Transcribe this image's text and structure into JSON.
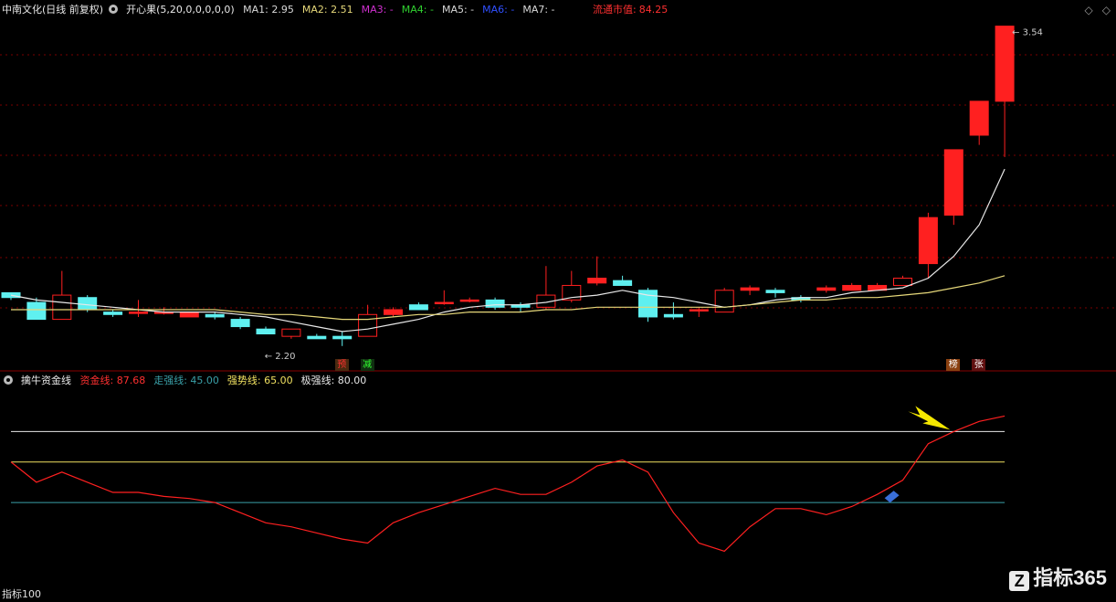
{
  "header": {
    "stock_title": "中南文化(日线 前复权)",
    "indicator_name": "开心果(5,20,0,0,0,0,0)",
    "ma": [
      {
        "label": "MA1:",
        "value": "2.95",
        "color": "#d8d8d8"
      },
      {
        "label": "MA2:",
        "value": "2.51",
        "color": "#e6d87a"
      },
      {
        "label": "MA3:",
        "value": "-",
        "color": "#d030d0"
      },
      {
        "label": "MA4:",
        "value": "-",
        "color": "#30d030"
      },
      {
        "label": "MA5:",
        "value": "-",
        "color": "#d8d8d8"
      },
      {
        "label": "MA6:",
        "value": "-",
        "color": "#3050ff"
      },
      {
        "label": "MA7:",
        "value": "-",
        "color": "#d8d8d8"
      }
    ],
    "market_cap_label": "流通市值:",
    "market_cap_value": "84.25"
  },
  "indicator_header": {
    "name": "擒牛资金线",
    "lines": [
      {
        "label": "资金线:",
        "value": "87.68",
        "color": "#ff3030"
      },
      {
        "label": "走强线:",
        "value": "45.00",
        "color": "#3aa0a8"
      },
      {
        "label": "强势线:",
        "value": "65.00",
        "color": "#f0e060"
      },
      {
        "label": "极强线:",
        "value": "80.00",
        "color": "#e8e8e8"
      }
    ]
  },
  "corner_icons": [
    "diamond-icon",
    "diamond-outline-icon"
  ],
  "footer_label": "指标100",
  "watermark": {
    "logo": "Z",
    "text": "指标365"
  },
  "colors": {
    "up": "#ff2020",
    "down": "#5ff0f0",
    "ma1": "#e8e8e8",
    "ma2": "#e6d87a",
    "grid": "#7a0000"
  },
  "chart_data": [
    {
      "type": "candlestick",
      "title": "中南文化(日线 前复权)",
      "annotations": {
        "high_label": "3.54",
        "low_label": "2.20"
      },
      "signal_tags": [
        {
          "index": 13,
          "text": "预",
          "color": "#ff3030",
          "bg": "#4a2a10"
        },
        {
          "index": 14,
          "text": "减",
          "color": "#30ff30",
          "bg": "#103010"
        },
        {
          "index": 37,
          "text": "榜",
          "color": "#ffffff",
          "bg": "#8a4010"
        },
        {
          "index": 38,
          "text": "张",
          "color": "#ffffff",
          "bg": "#601010"
        }
      ],
      "ylim": [
        2.14,
        3.58
      ],
      "candles": [
        {
          "o": 2.44,
          "c": 2.42,
          "h": 2.44,
          "l": 2.41
        },
        {
          "o": 2.4,
          "c": 2.33,
          "h": 2.42,
          "l": 2.33
        },
        {
          "o": 2.33,
          "c": 2.43,
          "h": 2.53,
          "l": 2.33
        },
        {
          "o": 2.42,
          "c": 2.37,
          "h": 2.43,
          "l": 2.36
        },
        {
          "o": 2.36,
          "c": 2.35,
          "h": 2.37,
          "l": 2.34
        },
        {
          "o": 2.36,
          "c": 2.36,
          "h": 2.41,
          "l": 2.34
        },
        {
          "o": 2.36,
          "c": 2.36,
          "h": 2.38,
          "l": 2.35
        },
        {
          "o": 2.34,
          "c": 2.36,
          "h": 2.36,
          "l": 2.34
        },
        {
          "o": 2.35,
          "c": 2.34,
          "h": 2.36,
          "l": 2.33
        },
        {
          "o": 2.33,
          "c": 2.3,
          "h": 2.34,
          "l": 2.29
        },
        {
          "o": 2.29,
          "c": 2.27,
          "h": 2.3,
          "l": 2.27
        },
        {
          "o": 2.26,
          "c": 2.29,
          "h": 2.29,
          "l": 2.25
        },
        {
          "o": 2.26,
          "c": 2.25,
          "h": 2.27,
          "l": 2.25
        },
        {
          "o": 2.26,
          "c": 2.25,
          "h": 2.28,
          "l": 2.22
        },
        {
          "o": 2.26,
          "c": 2.35,
          "h": 2.39,
          "l": 2.26
        },
        {
          "o": 2.35,
          "c": 2.37,
          "h": 2.38,
          "l": 2.34
        },
        {
          "o": 2.39,
          "c": 2.37,
          "h": 2.4,
          "l": 2.37
        },
        {
          "o": 2.4,
          "c": 2.4,
          "h": 2.45,
          "l": 2.39
        },
        {
          "o": 2.41,
          "c": 2.41,
          "h": 2.42,
          "l": 2.4
        },
        {
          "o": 2.41,
          "c": 2.38,
          "h": 2.42,
          "l": 2.37
        },
        {
          "o": 2.39,
          "c": 2.38,
          "h": 2.4,
          "l": 2.36
        },
        {
          "o": 2.38,
          "c": 2.43,
          "h": 2.55,
          "l": 2.37
        },
        {
          "o": 2.41,
          "c": 2.47,
          "h": 2.53,
          "l": 2.4
        },
        {
          "o": 2.48,
          "c": 2.5,
          "h": 2.59,
          "l": 2.47
        },
        {
          "o": 2.49,
          "c": 2.47,
          "h": 2.51,
          "l": 2.47
        },
        {
          "o": 2.45,
          "c": 2.34,
          "h": 2.46,
          "l": 2.32
        },
        {
          "o": 2.35,
          "c": 2.34,
          "h": 2.4,
          "l": 2.33
        },
        {
          "o": 2.37,
          "c": 2.37,
          "h": 2.38,
          "l": 2.34
        },
        {
          "o": 2.36,
          "c": 2.45,
          "h": 2.46,
          "l": 2.36
        },
        {
          "o": 2.45,
          "c": 2.46,
          "h": 2.47,
          "l": 2.43
        },
        {
          "o": 2.45,
          "c": 2.44,
          "h": 2.46,
          "l": 2.42
        },
        {
          "o": 2.42,
          "c": 2.41,
          "h": 2.43,
          "l": 2.4
        },
        {
          "o": 2.45,
          "c": 2.46,
          "h": 2.47,
          "l": 2.44
        },
        {
          "o": 2.45,
          "c": 2.47,
          "h": 2.48,
          "l": 2.45
        },
        {
          "o": 2.45,
          "c": 2.47,
          "h": 2.48,
          "l": 2.45
        },
        {
          "o": 2.47,
          "c": 2.5,
          "h": 2.51,
          "l": 2.47
        },
        {
          "o": 2.56,
          "c": 2.75,
          "h": 2.77,
          "l": 2.5
        },
        {
          "o": 2.76,
          "c": 3.03,
          "h": 3.03,
          "l": 2.72
        },
        {
          "o": 3.09,
          "c": 3.23,
          "h": 3.23,
          "l": 3.05
        },
        {
          "o": 3.23,
          "c": 3.54,
          "h": 3.54,
          "l": 3.0
        }
      ],
      "ma1": [
        2.43,
        2.41,
        2.4,
        2.39,
        2.38,
        2.37,
        2.36,
        2.36,
        2.36,
        2.35,
        2.34,
        2.32,
        2.3,
        2.28,
        2.29,
        2.31,
        2.33,
        2.36,
        2.38,
        2.39,
        2.39,
        2.4,
        2.42,
        2.43,
        2.45,
        2.43,
        2.42,
        2.4,
        2.38,
        2.39,
        2.41,
        2.42,
        2.42,
        2.44,
        2.45,
        2.46,
        2.5,
        2.59,
        2.72,
        2.95
      ],
      "ma2": [
        2.37,
        2.37,
        2.37,
        2.37,
        2.37,
        2.37,
        2.37,
        2.37,
        2.37,
        2.36,
        2.35,
        2.35,
        2.34,
        2.33,
        2.33,
        2.34,
        2.35,
        2.35,
        2.36,
        2.36,
        2.36,
        2.37,
        2.37,
        2.38,
        2.38,
        2.38,
        2.38,
        2.38,
        2.38,
        2.39,
        2.4,
        2.41,
        2.41,
        2.42,
        2.42,
        2.43,
        2.44,
        2.46,
        2.48,
        2.51
      ]
    },
    {
      "type": "line",
      "title": "擒牛资金线",
      "ylim": [
        0,
        100
      ],
      "hlines": [
        {
          "name": "走强线",
          "value": 45,
          "color": "#3aa0a8"
        },
        {
          "name": "强势线",
          "value": 65,
          "color": "#f0e060"
        },
        {
          "name": "极强线",
          "value": 80,
          "color": "#e8e8e8"
        }
      ],
      "series": [
        {
          "name": "资金线",
          "color": "#ff2020",
          "values": [
            65,
            55,
            60,
            55,
            50,
            50,
            48,
            47,
            45,
            40,
            35,
            33,
            30,
            27,
            25,
            35,
            40,
            44,
            48,
            52,
            49,
            49,
            55,
            63,
            66,
            60,
            40,
            25,
            21,
            33,
            42,
            42,
            39,
            43,
            49,
            56,
            74,
            80,
            85,
            87.68
          ]
        }
      ]
    }
  ]
}
